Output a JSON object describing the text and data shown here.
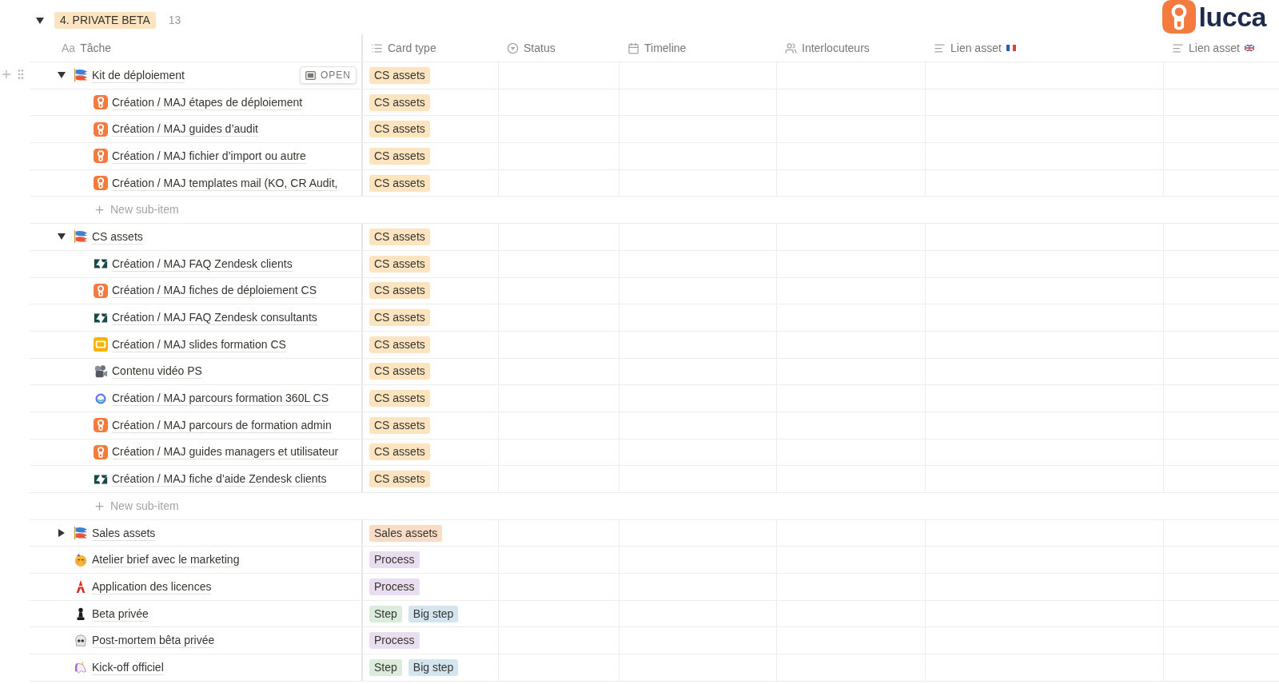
{
  "logo": {
    "text": "lucca"
  },
  "group": {
    "label": "4. PRIVATE BETA",
    "count": "13",
    "expanded": true
  },
  "columns": [
    {
      "kind": "title",
      "prefix": "Aa",
      "label": "Tâche"
    },
    {
      "kind": "select",
      "label": "Card type"
    },
    {
      "kind": "status",
      "label": "Status"
    },
    {
      "kind": "date",
      "label": "Timeline"
    },
    {
      "kind": "person",
      "label": "Interlocuteurs"
    },
    {
      "kind": "textfr",
      "label": "Lien asset"
    },
    {
      "kind": "textgb",
      "label": "Lien asset"
    }
  ],
  "rows": [
    {
      "title": "Kit de déploiement",
      "kind": "streamer",
      "expanded": true,
      "open_label": "OPEN",
      "tags": [
        {
          "label": "CS assets",
          "color": "#fbe4bf"
        }
      ],
      "children": [
        {
          "title": "Création / MAJ étapes de déploiement",
          "kind": "lucca",
          "tags": [
            {
              "label": "CS assets",
              "color": "#fbe4bf"
            }
          ]
        },
        {
          "title": "Création / MAJ guides d’audit",
          "kind": "lucca",
          "tags": [
            {
              "label": "CS assets",
              "color": "#fbe4bf"
            }
          ]
        },
        {
          "title": "Création / MAJ fichier d’import ou autre",
          "kind": "lucca",
          "tags": [
            {
              "label": "CS assets",
              "color": "#fbe4bf"
            }
          ]
        },
        {
          "title": "Création / MAJ templates mail (KO, CR Audit,",
          "kind": "lucca",
          "tags": [
            {
              "label": "CS assets",
              "color": "#fbe4bf"
            }
          ]
        }
      ],
      "new_sub_item": "New sub-item"
    },
    {
      "title": "CS assets",
      "kind": "streamer",
      "expanded": true,
      "tags": [
        {
          "label": "CS assets",
          "color": "#fbe4bf"
        }
      ],
      "children": [
        {
          "title": "Création / MAJ FAQ Zendesk clients",
          "kind": "zendesk",
          "tags": [
            {
              "label": "CS assets",
              "color": "#fbe4bf"
            }
          ]
        },
        {
          "title": "Création / MAJ fiches de déploiement CS",
          "kind": "lucca",
          "tags": [
            {
              "label": "CS assets",
              "color": "#fbe4bf"
            }
          ]
        },
        {
          "title": "Création / MAJ FAQ Zendesk consultants",
          "kind": "zendesk",
          "tags": [
            {
              "label": "CS assets",
              "color": "#fbe4bf"
            }
          ]
        },
        {
          "title": "Création / MAJ slides formation CS",
          "kind": "slides",
          "tags": [
            {
              "label": "CS assets",
              "color": "#fbe4bf"
            }
          ]
        },
        {
          "title": "Contenu vidéo PS",
          "kind": "camera",
          "tags": [
            {
              "label": "CS assets",
              "color": "#fbe4bf"
            }
          ]
        },
        {
          "title": "Création / MAJ parcours formation 360L CS",
          "kind": "ring",
          "tags": [
            {
              "label": "CS assets",
              "color": "#fbe4bf"
            }
          ]
        },
        {
          "title": "Création / MAJ parcours de formation admin",
          "kind": "lucca",
          "tags": [
            {
              "label": "CS assets",
              "color": "#fbe4bf"
            }
          ]
        },
        {
          "title": "Création / MAJ guides managers et utilisateur",
          "kind": "lucca",
          "tags": [
            {
              "label": "CS assets",
              "color": "#fbe4bf"
            }
          ]
        },
        {
          "title": "Création / MAJ fiche d’aide Zendesk clients",
          "kind": "zendesk",
          "tags": [
            {
              "label": "CS assets",
              "color": "#fbe4bf"
            }
          ]
        }
      ],
      "new_sub_item": "New sub-item"
    },
    {
      "title": "Sales assets",
      "kind": "streamer",
      "expanded": false,
      "tags": [
        {
          "label": "Sales assets",
          "color": "#f9dcc6"
        }
      ]
    },
    {
      "title": "Atelier brief avec le marketing",
      "kind": "party",
      "tags": [
        {
          "label": "Process",
          "color": "#e9def0"
        }
      ]
    },
    {
      "title": "Application des licences",
      "kind": "tower",
      "tags": [
        {
          "label": "Process",
          "color": "#e9def0"
        }
      ]
    },
    {
      "title": "Beta privée",
      "kind": "pawn",
      "tags": [
        {
          "label": "Step",
          "color": "#dcecdc"
        },
        {
          "label": "Big step",
          "color": "#d5e5ef"
        }
      ]
    },
    {
      "title": "Post-mortem bêta privée",
      "kind": "skull",
      "tags": [
        {
          "label": "Process",
          "color": "#e9def0"
        }
      ]
    },
    {
      "title": "Kick-off officiel",
      "kind": "unicorn",
      "tags": [
        {
          "label": "Step",
          "color": "#dcecdc"
        },
        {
          "label": "Big step",
          "color": "#d5e5ef"
        }
      ]
    }
  ]
}
